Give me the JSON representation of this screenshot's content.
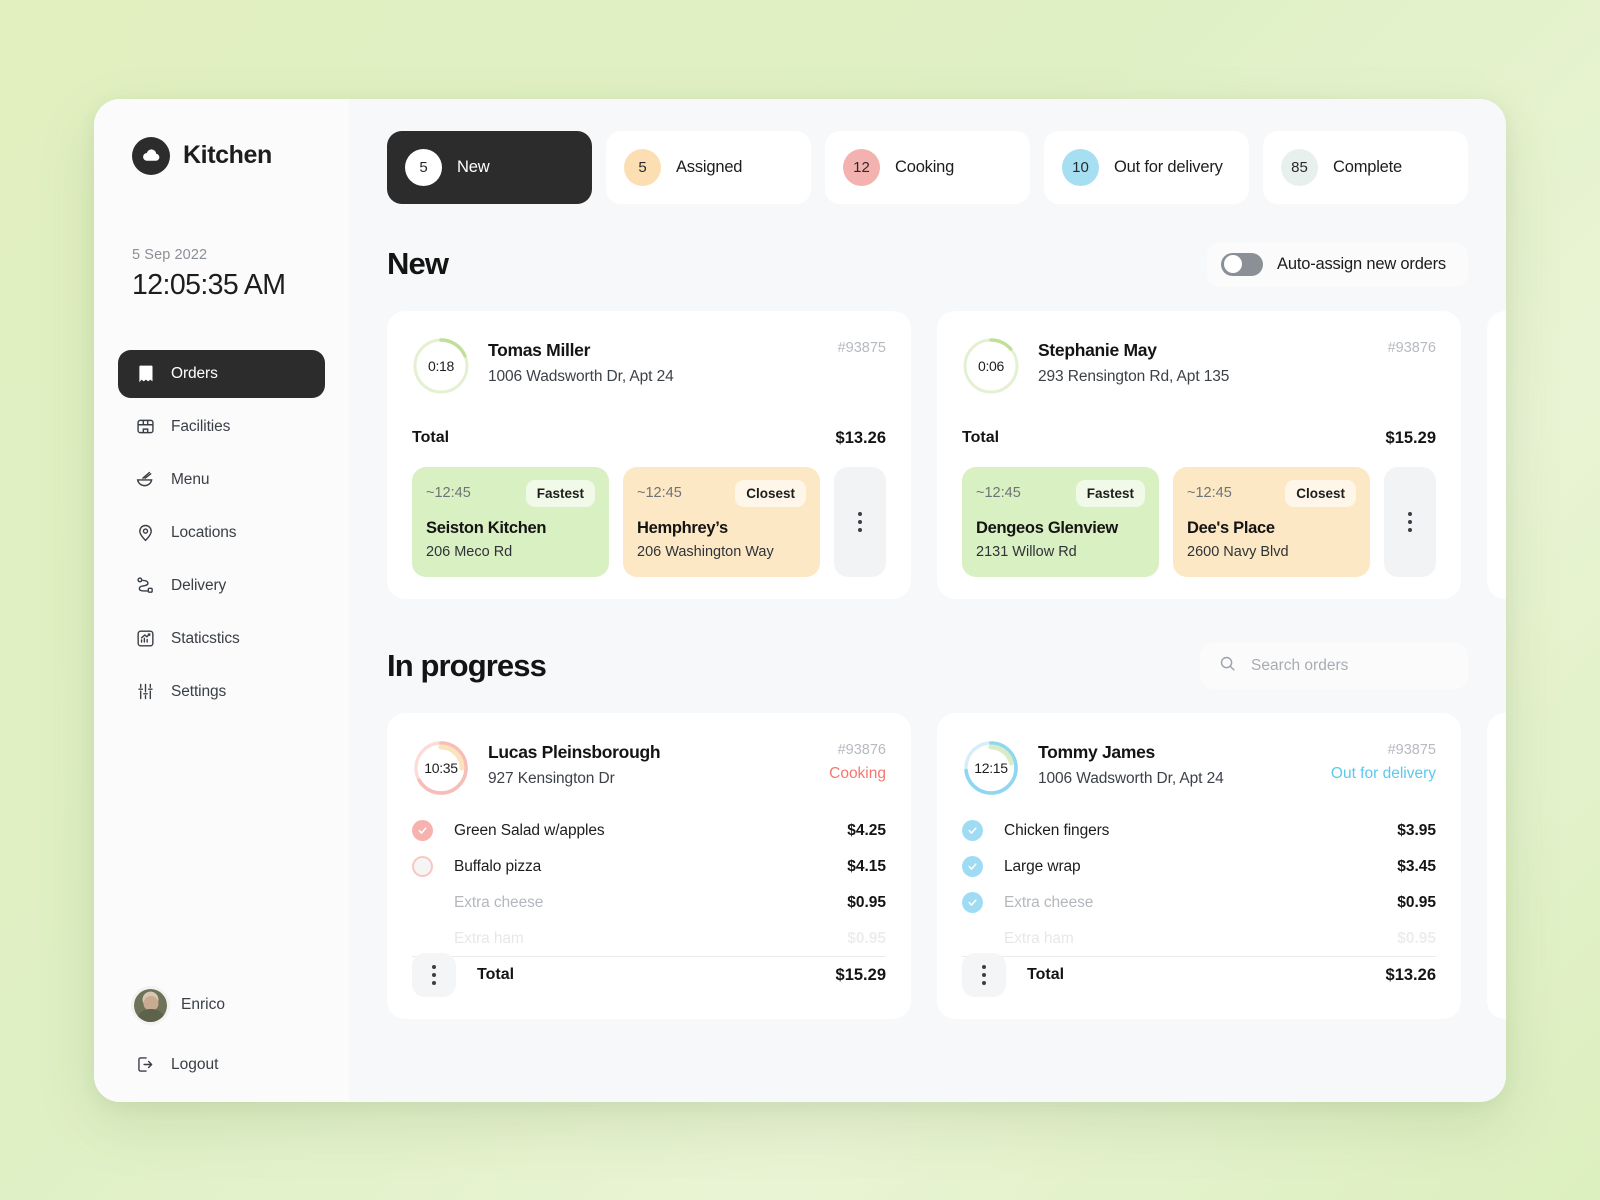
{
  "brand": {
    "name": "Kitchen",
    "logo_icon": "cloud-icon"
  },
  "clock": {
    "date": "5 Sep 2022",
    "time": "12:05:35 AM"
  },
  "sidebar": {
    "items": [
      {
        "label": "Orders",
        "icon": "receipt-icon",
        "active": true
      },
      {
        "label": "Facilities",
        "icon": "building-icon",
        "active": false
      },
      {
        "label": "Menu",
        "icon": "bowl-icon",
        "active": false
      },
      {
        "label": "Locations",
        "icon": "pin-icon",
        "active": false
      },
      {
        "label": "Delivery",
        "icon": "route-icon",
        "active": false
      },
      {
        "label": "Staticstics",
        "icon": "chart-icon",
        "active": false
      },
      {
        "label": "Settings",
        "icon": "sliders-icon",
        "active": false
      }
    ],
    "user": {
      "name": "Enrico",
      "avatar_icon": "avatar"
    },
    "logout": {
      "label": "Logout",
      "icon": "logout-icon"
    }
  },
  "tabs": [
    {
      "count": "5",
      "label": "New",
      "color": "#ffffff",
      "active": true
    },
    {
      "count": "5",
      "label": "Assigned",
      "color": "#fbdfb2",
      "active": false
    },
    {
      "count": "12",
      "label": "Cooking",
      "color": "#f3b2b0",
      "active": false
    },
    {
      "count": "10",
      "label": "Out for delivery",
      "color": "#a6dff2",
      "active": false
    },
    {
      "count": "85",
      "label": "Complete",
      "color": "#e7f0ec",
      "active": false
    }
  ],
  "new_section": {
    "title": "New",
    "auto_assign": {
      "label": "Auto-assign new orders",
      "enabled": false
    },
    "orders": [
      {
        "timer": "0:18",
        "timer_progress": 18,
        "ring_color": "#c3e29b",
        "customer": "Tomas Miller",
        "address": "1006 Wadsworth Dr, Apt 24",
        "order_id": "#93875",
        "total_label": "Total",
        "total": "$13.26",
        "kitchens": [
          {
            "eta": "~12:45",
            "badge": "Fastest",
            "name": "Seiston Kitchen",
            "address": "206 Meco Rd",
            "tone": "green"
          },
          {
            "eta": "~12:45",
            "badge": "Closest",
            "name": "Hemphrey’s",
            "address": "206 Washington Way",
            "tone": "orange"
          }
        ]
      },
      {
        "timer": "0:06",
        "timer_progress": 12,
        "ring_color": "#c3e29b",
        "customer": "Stephanie May",
        "address": "293 Rensington Rd, Apt 135",
        "order_id": "#93876",
        "total_label": "Total",
        "total": "$15.29",
        "kitchens": [
          {
            "eta": "~12:45",
            "badge": "Fastest",
            "name": "Dengeos Glenview",
            "address": "2131 Willow Rd",
            "tone": "green"
          },
          {
            "eta": "~12:45",
            "badge": "Closest",
            "name": "Dee's Place",
            "address": "2600 Navy Blvd",
            "tone": "orange"
          }
        ]
      }
    ]
  },
  "progress_section": {
    "title": "In progress",
    "search": {
      "placeholder": "Search orders",
      "value": "",
      "icon": "search-icon"
    },
    "orders": [
      {
        "timer": "10:35",
        "ring_color": "#f4b8b4",
        "ring_accent": "#fbe3bd",
        "customer": "Lucas Pleinsborough",
        "address": "927 Kensington Dr",
        "order_id": "#93876",
        "status": "Cooking",
        "status_color": "#f9766e",
        "tone": "pink",
        "items": [
          {
            "name": "Green Salad w/apples",
            "price": "$4.25",
            "state": "done"
          },
          {
            "name": "Buffalo pizza",
            "price": "$4.15",
            "state": "pending"
          },
          {
            "name": "Extra cheese",
            "price": "$0.95",
            "state": "none"
          },
          {
            "name": "Extra ham",
            "price": "$0.95",
            "state": "none"
          }
        ],
        "total_label": "Total",
        "total": "$15.29"
      },
      {
        "timer": "12:15",
        "ring_color": "#9fdcf4",
        "ring_accent": "#d9ecc6",
        "customer": "Tommy James",
        "address": "1006 Wadsworth Dr, Apt 24",
        "order_id": "#93875",
        "status": "Out for delivery",
        "status_color": "#5cc8ef",
        "tone": "blue",
        "items": [
          {
            "name": "Chicken fingers",
            "price": "$3.95",
            "state": "done"
          },
          {
            "name": "Large wrap",
            "price": "$3.45",
            "state": "done"
          },
          {
            "name": "Extra cheese",
            "price": "$0.95",
            "state": "done"
          },
          {
            "name": "Extra ham",
            "price": "$0.95",
            "state": "none"
          }
        ],
        "total_label": "Total",
        "total": "$13.26"
      }
    ]
  }
}
